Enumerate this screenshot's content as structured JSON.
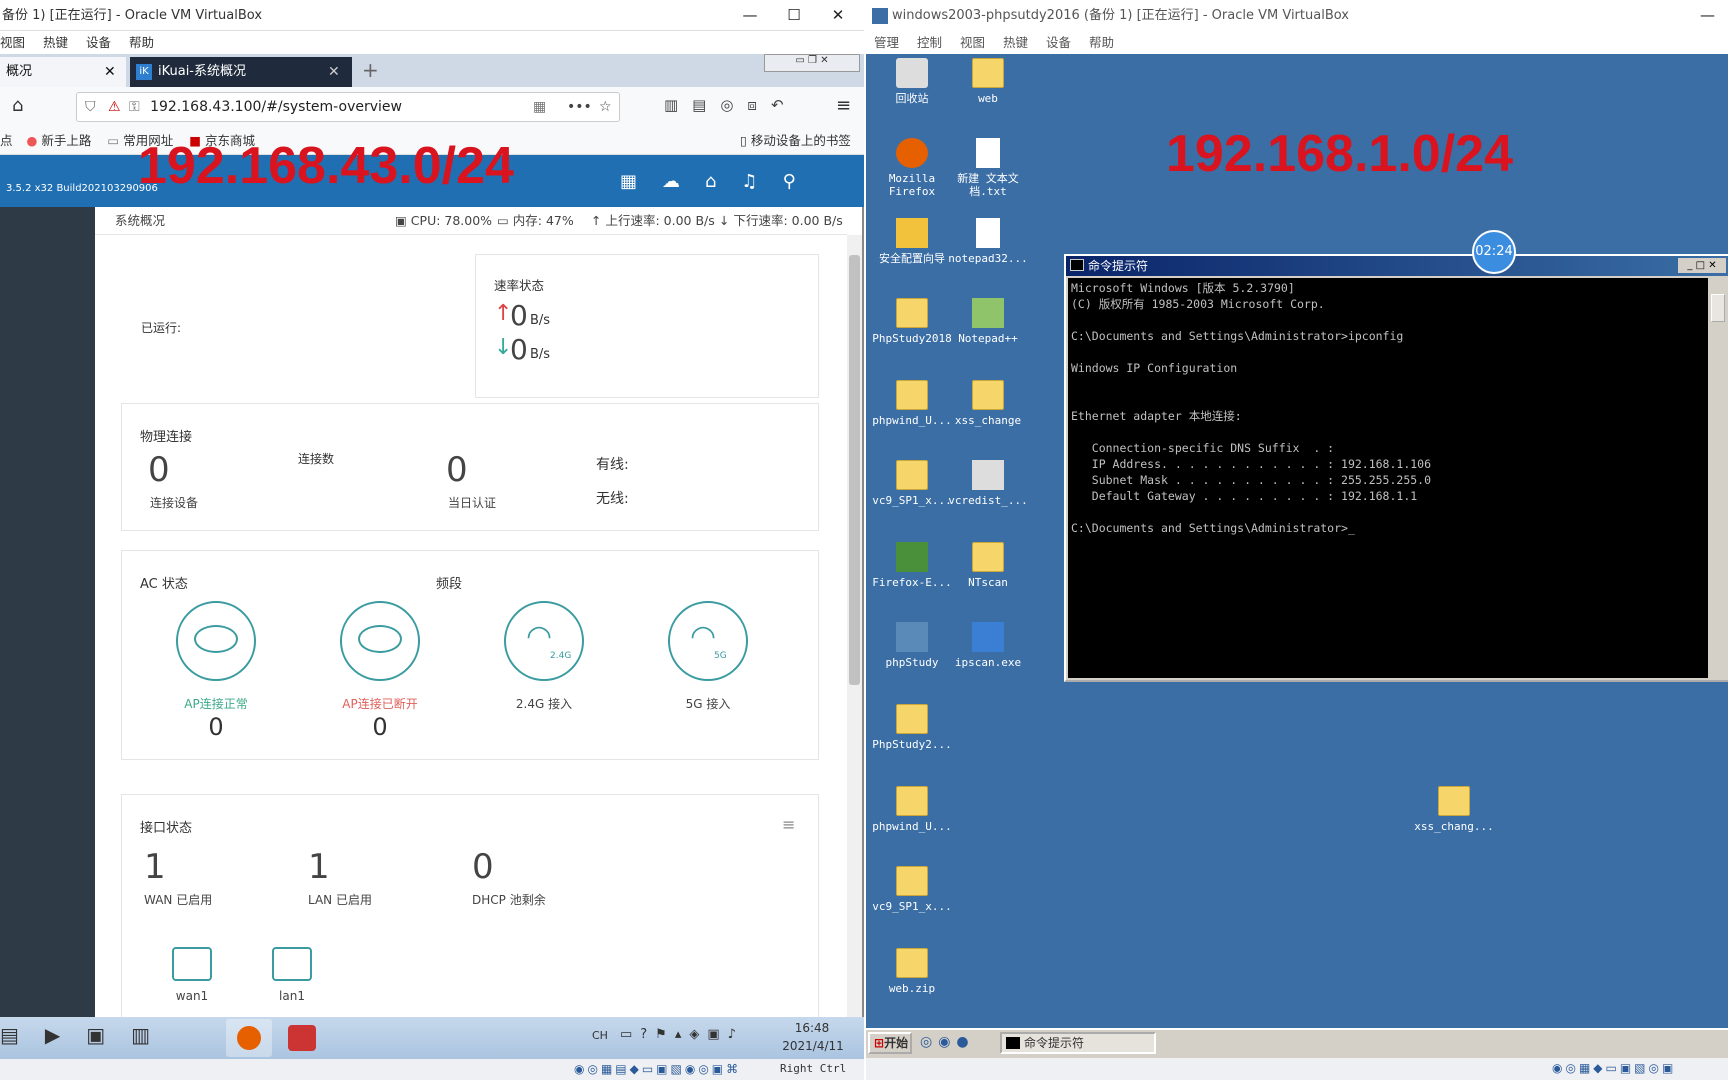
{
  "left_vm": {
    "title": "备份 1) [正在运行] - Oracle VM VirtualBox",
    "menu": [
      "视图",
      "热键",
      "设备",
      "帮助"
    ],
    "browser": {
      "tab1": "概况",
      "tab2": "iKuai-系统概况",
      "url": "192.168.43.100/#/system-overview",
      "bookmarks": [
        "点",
        "新手上路",
        "常用网址",
        "京东商城"
      ],
      "mobile_bookmarks": "移动设备上的书签"
    },
    "annotation": "192.168.43.0/24",
    "ikuai": {
      "version": "3.5.2 x32 Build202103290906",
      "breadcrumb": "系统概况",
      "cpu": "CPU: 78.00%",
      "mem": "内存: 47%",
      "up": "上行速率: 0.00 B/s",
      "down": "下行速率: 0.00 B/s",
      "running_label": "已运行:",
      "speed_title": "速率状态",
      "speed_up_value": "0",
      "speed_down_value": "0",
      "speed_unit": "B/s",
      "phys_title": "物理连接",
      "connections_label": "连接数",
      "devices_value": "0",
      "devices_label": "连接设备",
      "auth_value": "0",
      "auth_label": "当日认证",
      "wired_label": "有线:",
      "wireless_label": "无线:",
      "ac_title": "AC 状态",
      "band_title": "频段",
      "ap_ok_label": "AP连接正常",
      "ap_ok_value": "0",
      "ap_off_label": "AP连接已断开",
      "ap_off_value": "0",
      "band_24_label": "2.4G 接入",
      "band_5_label": "5G 接入",
      "band_24_tag": "2.4G",
      "band_5_tag": "5G",
      "iface_title": "接口状态",
      "wan_value": "1",
      "wan_label": "WAN 已启用",
      "lan_value": "1",
      "lan_label": "LAN 已启用",
      "dhcp_value": "0",
      "dhcp_label": "DHCP 池剩余",
      "port1": "wan1",
      "port2": "lan1"
    },
    "taskbar": {
      "lang": "CH",
      "time": "16:48",
      "date": "2021/4/11",
      "hostkey": "Right Ctrl"
    }
  },
  "right_vm": {
    "title": "windows2003-phpsutdy2016 (备份 1) [正在运行] - Oracle VM VirtualBox",
    "menu": [
      "管理",
      "控制",
      "视图",
      "热键",
      "设备",
      "帮助"
    ],
    "annotation": "192.168.1.0/24",
    "timer": "02:24",
    "desktop_icons": [
      {
        "label": "回收站"
      },
      {
        "label": "web"
      },
      {
        "label": "Mozilla Firefox"
      },
      {
        "label": "新建 文本文档.txt"
      },
      {
        "label": "安全配置向导"
      },
      {
        "label": "notepad32..."
      },
      {
        "label": "PhpStudy2018"
      },
      {
        "label": "Notepad++"
      },
      {
        "label": "phpwind_U..."
      },
      {
        "label": "xss_change"
      },
      {
        "label": "vc9_SP1_x..."
      },
      {
        "label": "vcredist_..."
      },
      {
        "label": "Firefox-E..."
      },
      {
        "label": "NTscan"
      },
      {
        "label": "phpStudy"
      },
      {
        "label": "ipscan.exe"
      },
      {
        "label": "PhpStudy2..."
      },
      {
        "label": "phpwind_U..."
      },
      {
        "label": "vc9_SP1_x..."
      },
      {
        "label": "web.zip"
      },
      {
        "label": "xss_chang..."
      }
    ],
    "cmd": {
      "title": "命令提示符",
      "lines": [
        "Microsoft Windows [版本 5.2.3790]",
        "(C) 版权所有 1985-2003 Microsoft Corp.",
        "",
        "C:\\Documents and Settings\\Administrator>ipconfig",
        "",
        "Windows IP Configuration",
        "",
        "",
        "Ethernet adapter 本地连接:",
        "",
        "   Connection-specific DNS Suffix  . :",
        "   IP Address. . . . . . . . . . . . : 192.168.1.106",
        "   Subnet Mask . . . . . . . . . . . : 255.255.255.0",
        "   Default Gateway . . . . . . . . . : 192.168.1.1",
        "",
        "C:\\Documents and Settings\\Administrator>_"
      ]
    },
    "taskbar": {
      "start": "开始",
      "task": "命令提示符"
    }
  }
}
